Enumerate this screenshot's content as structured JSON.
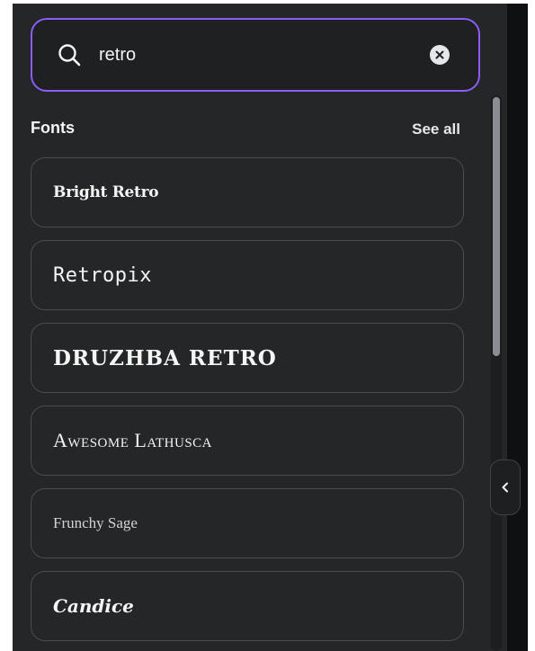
{
  "search": {
    "value": "retro",
    "icon": "search-icon",
    "clear_icon": "close-icon"
  },
  "fonts_section": {
    "title": "Fonts",
    "see_all_label": "See all",
    "items": [
      {
        "label": "Bright Retro"
      },
      {
        "label": "Retropix"
      },
      {
        "label": "DRUZHBA RETRO"
      },
      {
        "label": "Awesome Lathusca"
      },
      {
        "label": "Frunchy Sage"
      },
      {
        "label": "Candice"
      }
    ]
  },
  "colors": {
    "panel_bg": "#252627",
    "accent_border": "#8b5cf6",
    "card_border": "#4a4c50"
  },
  "collapse_tab": {
    "icon": "chevron-left-icon"
  }
}
